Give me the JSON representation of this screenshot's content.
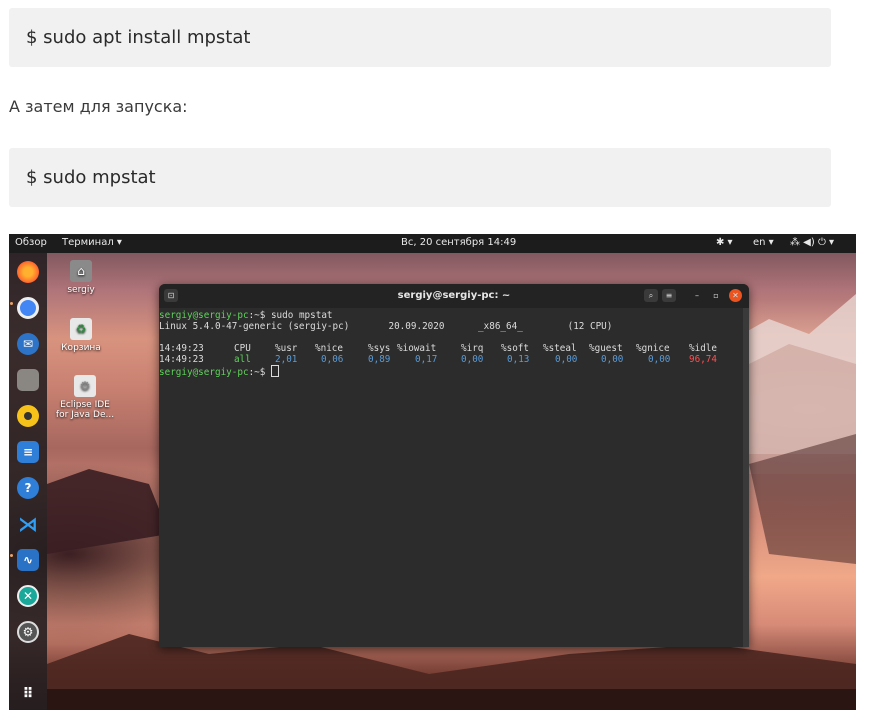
{
  "article": {
    "cmd1": "$ sudo apt install mpstat",
    "para": "А затем для запуска:",
    "cmd2": "$  sudo mpstat"
  },
  "topbar": {
    "activities": "Обзор",
    "app_menu": "Терминал ▾",
    "datetime": "Вс, 20 сентября  14:49",
    "accessibility": "✱ ▾",
    "lang": "en ▾",
    "status": "⁂ ◀) ⏻ ▾"
  },
  "desktop": {
    "icons": [
      {
        "label": "sergiy"
      },
      {
        "label": "Корзина"
      },
      {
        "label": "Eclipse IDE for Java De..."
      }
    ]
  },
  "terminal": {
    "title": "sergiy@sergiy-pc: ~",
    "prompt_user": "sergiy@sergiy-pc",
    "prompt_path": ":~$ ",
    "command": "sudo mpstat",
    "sysinfo": "Linux 5.4.0-47-generic (sergiy-pc)       20.09.2020      _x86_64_        (12 CPU)",
    "time": "14:49:23",
    "headers": [
      "CPU",
      "%usr",
      "%nice",
      "%sys",
      "%iowait",
      "%irq",
      "%soft",
      "%steal",
      "%guest",
      "%gnice",
      "%idle"
    ],
    "values": [
      "all",
      "2,01",
      "0,06",
      "0,89",
      "0,17",
      "0,00",
      "0,13",
      "0,00",
      "0,00",
      "0,00",
      "96,74"
    ]
  },
  "colors": {
    "prompt": "#5fd35b",
    "value": "#5b9bd5",
    "idle": "#ff5050"
  }
}
